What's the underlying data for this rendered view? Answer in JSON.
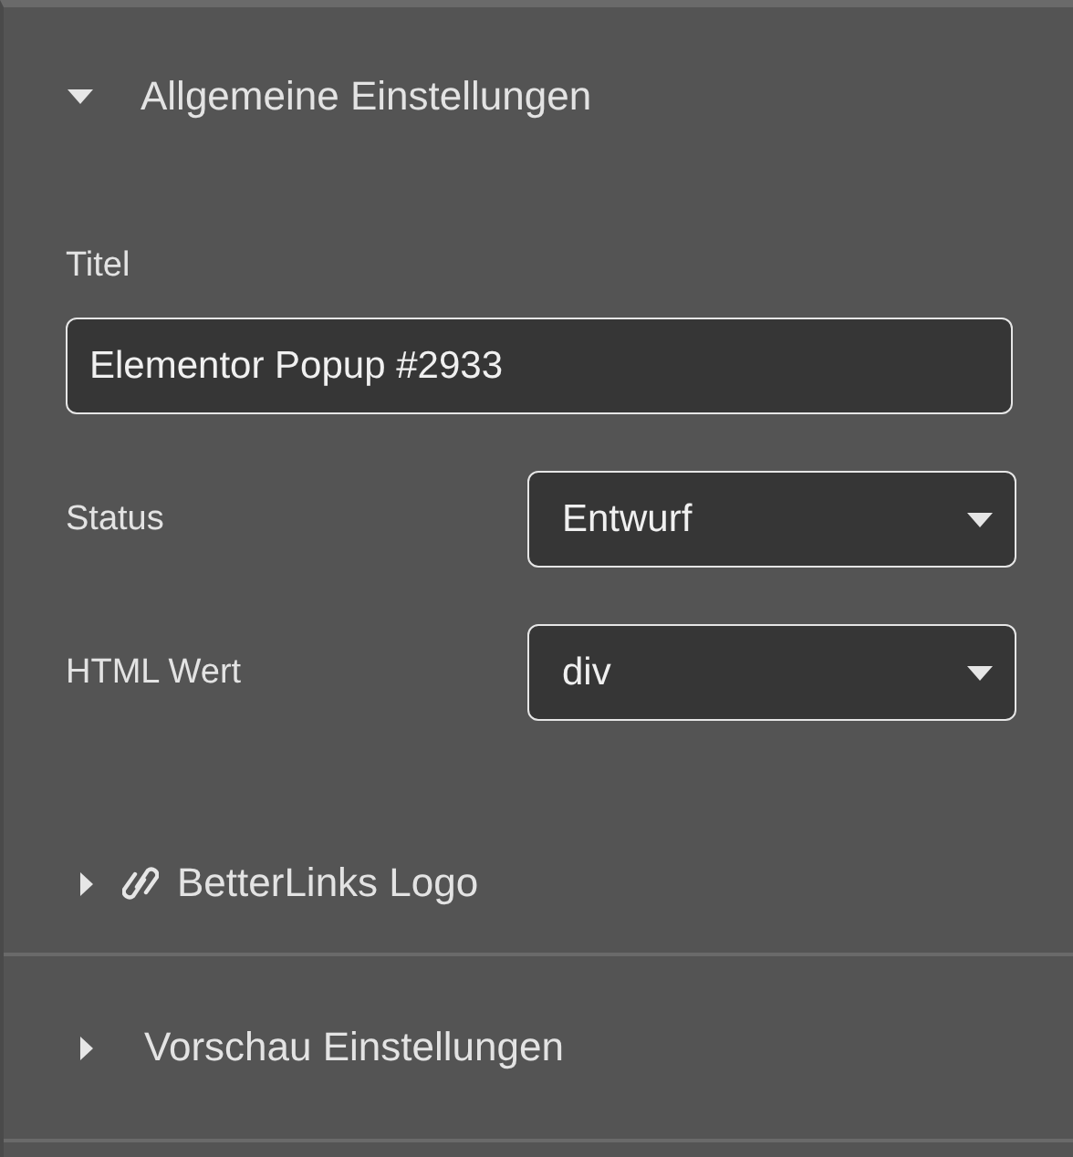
{
  "sections": [
    {
      "kind": "plain",
      "title": "Allgemeine Einstellungen",
      "expanded": true,
      "fields": [
        {
          "kind": "text",
          "label": "Titel",
          "value": "Elementor Popup #2933"
        },
        {
          "kind": "select",
          "label": "Status",
          "value": "Entwurf"
        },
        {
          "kind": "select",
          "label": "HTML Wert",
          "value": "div"
        }
      ]
    },
    {
      "kind": "link",
      "title": "BetterLinks Logo",
      "expanded": false
    },
    {
      "kind": "plain",
      "title": "Vorschau Einstellungen",
      "expanded": false
    }
  ]
}
